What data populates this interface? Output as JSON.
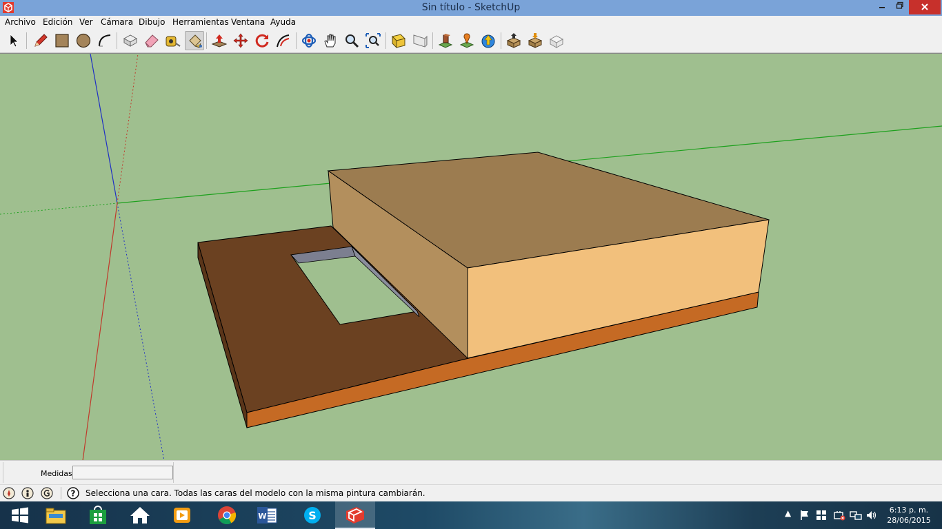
{
  "window": {
    "title": "Sin título - SketchUp"
  },
  "menu": {
    "items": [
      {
        "label": "Archivo"
      },
      {
        "label": "Edición"
      },
      {
        "label": "Ver"
      },
      {
        "label": "Cámara"
      },
      {
        "label": "Dibujo"
      },
      {
        "label": "Herramientas"
      },
      {
        "label": "Ventana"
      },
      {
        "label": "Ayuda"
      }
    ]
  },
  "toolbar": {
    "tools": [
      {
        "name": "select-tool",
        "icon": "arrow-cursor-icon"
      },
      {
        "name": "line-tool",
        "icon": "pencil-icon"
      },
      {
        "name": "rectangle-tool",
        "icon": "rectangle-icon"
      },
      {
        "name": "circle-tool",
        "icon": "circle-icon"
      },
      {
        "name": "arc-tool",
        "icon": "arc-icon"
      },
      {
        "name": "make-component-tool",
        "icon": "component-box-icon"
      },
      {
        "name": "eraser-tool",
        "icon": "eraser-icon"
      },
      {
        "name": "tape-measure-tool",
        "icon": "tape-measure-icon"
      },
      {
        "name": "paint-bucket-tool",
        "icon": "paint-bucket-icon",
        "active": true
      },
      {
        "name": "push-pull-tool",
        "icon": "push-pull-icon"
      },
      {
        "name": "move-tool",
        "icon": "move-arrows-icon"
      },
      {
        "name": "rotate-tool",
        "icon": "rotate-icon"
      },
      {
        "name": "follow-me-tool",
        "icon": "follow-me-icon"
      },
      {
        "name": "orbit-tool",
        "icon": "orbit-icon"
      },
      {
        "name": "pan-tool",
        "icon": "hand-icon"
      },
      {
        "name": "zoom-tool",
        "icon": "magnifier-icon"
      },
      {
        "name": "zoom-extents-tool",
        "icon": "zoom-extents-icon"
      },
      {
        "name": "previous-view-tool",
        "icon": "previous-view-icon"
      },
      {
        "name": "next-view-tool",
        "icon": "next-view-icon"
      },
      {
        "name": "get-models-tool",
        "icon": "warehouse-icon"
      },
      {
        "name": "add-location-tool",
        "icon": "location-pin-icon"
      },
      {
        "name": "share-model-tool",
        "icon": "globe-upload-icon"
      },
      {
        "name": "get-components-tool",
        "icon": "download-box-icon"
      },
      {
        "name": "share-component-tool",
        "icon": "upload-box-icon"
      },
      {
        "name": "extension-warehouse-tool",
        "icon": "extension-box-icon"
      }
    ]
  },
  "measurements": {
    "label": "Medidas",
    "value": ""
  },
  "status": {
    "message": "Selecciona una cara. Todas las caras del modelo con la misma pintura cambiarán."
  },
  "taskbar": {
    "apps": [
      {
        "name": "start",
        "icon": "windows-logo-icon"
      },
      {
        "name": "file-explorer",
        "icon": "folder-icon"
      },
      {
        "name": "store",
        "icon": "store-bag-icon"
      },
      {
        "name": "home",
        "icon": "home-icon"
      },
      {
        "name": "media-player",
        "icon": "play-icon"
      },
      {
        "name": "chrome",
        "icon": "chrome-icon"
      },
      {
        "name": "word",
        "icon": "word-icon"
      },
      {
        "name": "skype",
        "icon": "skype-icon"
      },
      {
        "name": "sketchup",
        "icon": "sketchup-icon",
        "active": true
      }
    ],
    "clock": {
      "time": "6:13 p. m.",
      "date": "28/06/2015"
    }
  },
  "colors": {
    "titlebar": "#7aa3d8",
    "viewport_bg": "#9fbf8f",
    "box_top": "#9c7c50",
    "box_left_side": "#b38f5d",
    "box_front": "#f2c07c",
    "slab_top": "#6b4121",
    "slab_edge": "#c56a24",
    "hole_shadow": "#7c7f90",
    "axis_red": "#c0392b",
    "axis_green": "#1da01d",
    "axis_blue": "#1f2fc4"
  }
}
